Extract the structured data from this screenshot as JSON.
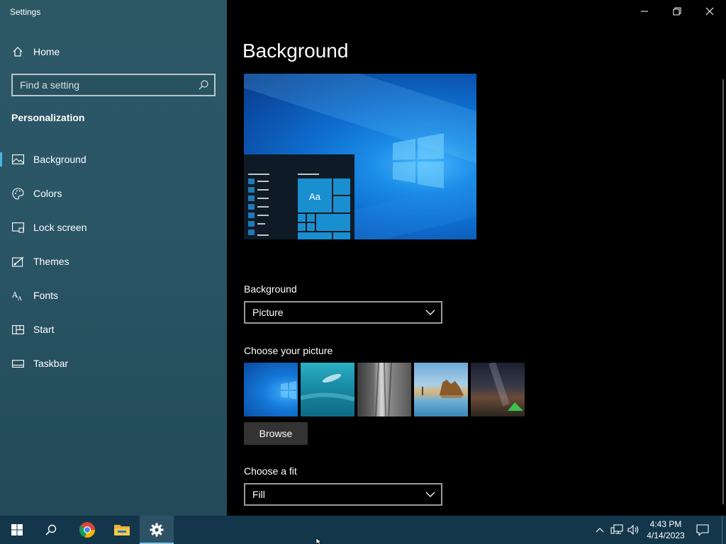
{
  "window": {
    "title": "Settings"
  },
  "sidebar": {
    "home_label": "Home",
    "search_placeholder": "Find a setting",
    "section": "Personalization",
    "items": [
      {
        "label": "Background",
        "icon": "picture-icon",
        "selected": true
      },
      {
        "label": "Colors",
        "icon": "palette-icon",
        "selected": false
      },
      {
        "label": "Lock screen",
        "icon": "lock-screen-icon",
        "selected": false
      },
      {
        "label": "Themes",
        "icon": "brush-icon",
        "selected": false
      },
      {
        "label": "Fonts",
        "icon": "fonts-icon",
        "selected": false
      },
      {
        "label": "Start",
        "icon": "start-icon",
        "selected": false
      },
      {
        "label": "Taskbar",
        "icon": "taskbar-icon",
        "selected": false
      }
    ]
  },
  "main": {
    "title": "Background",
    "preview_tile_text": "Aa",
    "background_label": "Background",
    "background_value": "Picture",
    "choose_picture_label": "Choose your picture",
    "browse_label": "Browse",
    "fit_label": "Choose a fit",
    "fit_value": "Fill"
  },
  "taskbar": {
    "time": "4:43 PM",
    "date": "4/14/2023"
  },
  "colors": {
    "accent": "#4fb3e8",
    "sidebar_bg": "#2a5565",
    "taskbar_bg": "#13364a"
  }
}
